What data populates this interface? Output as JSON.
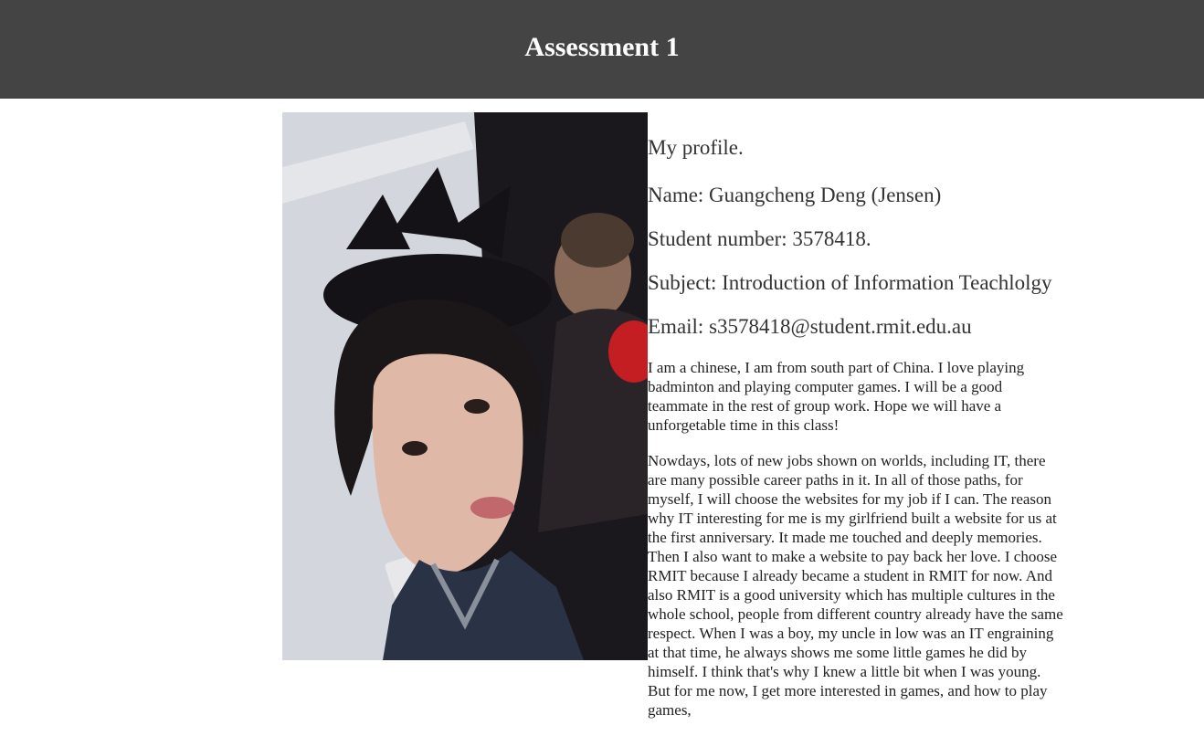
{
  "header": {
    "title": "Assessment 1"
  },
  "photo": {
    "alt": "profile photo",
    "accent": "#444444"
  },
  "profile": {
    "heading": "My profile.",
    "name": "Name: Guangcheng Deng (Jensen)",
    "student_number": "Student number: 3578418.",
    "subject": "Subject: Introduction of Information Teachlolgy",
    "email": "Email: s3578418@student.rmit.edu.au",
    "paragraphs": [
      "I am a chinese, I am from south part of China. I love playing badminton and playing computer games. I will be a good teammate in the rest of group work. Hope we will have a unforgetable time in this class!",
      "Nowdays, lots of new jobs shown on worlds, including IT, there are many possible career paths in it. In all of those paths, for myself, I will choose the websites for my job if I can. The reason why IT interesting for me is my girlfriend built a website for us at the first anniversary. It made me touched and deeply memories. Then I also want to make a website to pay back her love. I choose RMIT because I already became a student in RMIT for now. And also RMIT is a good university which has multiple cultures in the whole school, people from different country already have the same respect. When I was a boy, my uncle in low was an IT engraining at that time, he always shows me some little games he did by himself. I think that's why I knew a little bit when I was young. But for me now, I get more interested in games, and how to play games,"
    ]
  }
}
